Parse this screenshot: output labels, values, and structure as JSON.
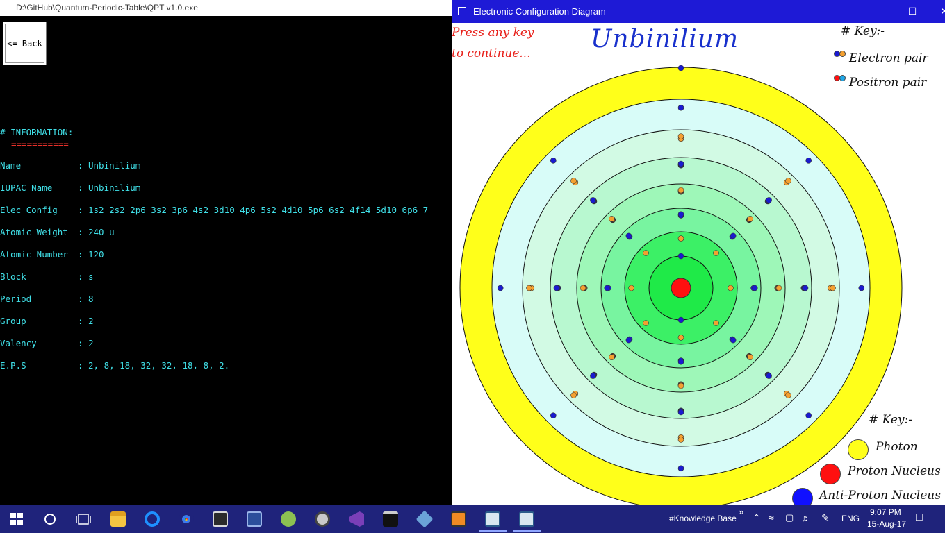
{
  "console": {
    "title": "D:\\GitHub\\Quantum-Periodic-Table\\QPT v1.0.exe",
    "back_label": "<= Back",
    "heading": "# INFORMATION:-",
    "underline": "===========",
    "rows": [
      {
        "key": "Name",
        "value": "Unbinilium"
      },
      {
        "key": "IUPAC Name",
        "value": "Unbinilium"
      },
      {
        "key": "Elec Config",
        "value": "1s2 2s2 2p6 3s2 3p6 4s2 3d10 4p6 5s2 4d10 5p6 6s2 4f14 5d10 6p6 7"
      },
      {
        "key": "Atomic Weight",
        "value": "240 u"
      },
      {
        "key": "Atomic Number",
        "value": "120"
      },
      {
        "key": "Block",
        "value": "s"
      },
      {
        "key": "Period",
        "value": "8"
      },
      {
        "key": "Group",
        "value": "2"
      },
      {
        "key": "Valency",
        "value": "2"
      },
      {
        "key": "E.P.S",
        "value": "2, 8, 18, 32, 32, 18, 8, 2."
      }
    ],
    "separator": ":"
  },
  "diagram": {
    "title": "Electronic Configuration Diagram",
    "press_line1": "Press any key",
    "press_line2": "to continue...",
    "element_name": "Unbinilium",
    "key_top": {
      "title": "# Key:-",
      "electron_pair": "Electron pair",
      "positron_pair": "Positron pair"
    },
    "key_bottom": {
      "title": "# Key:-",
      "photon": "Photon",
      "proton": "Proton Nucleus",
      "antiproton": "Anti-Proton Nucleus"
    },
    "shell_electrons": [
      2,
      8,
      18,
      32,
      32,
      18,
      8,
      2
    ],
    "colors": {
      "electron": "#1a1ad0",
      "positron_pair": "#f4a030",
      "photon": "#ffff1a",
      "proton": "#ff1010",
      "antiproton": "#1010ff",
      "shell_light": "#d8fcf8",
      "shell_green": "#22ee55"
    }
  },
  "taskbar": {
    "apps": [
      "start-icon",
      "cortana-icon",
      "task-view-icon",
      "file-explorer-icon",
      "edge-icon",
      "chrome-icon",
      "xd-icon",
      "devcpp-icon",
      "android-studio-icon",
      "app-icon",
      "visual-studio-icon",
      "cmd-icon",
      "virtualbox-icon",
      "sublime-icon",
      "console-app-icon",
      "diagram-app-icon"
    ],
    "toolbar_label": "#Knowledge Base",
    "language": "ENG",
    "time": "9:07 PM",
    "date": "15-Aug-17"
  }
}
